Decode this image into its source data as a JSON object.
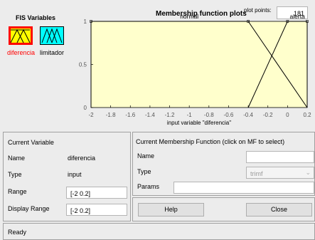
{
  "fis_variables": {
    "title": "FIS Variables",
    "inputs": [
      {
        "name": "diferencia",
        "selected": true
      }
    ],
    "outputs": [
      {
        "name": "limitador"
      }
    ]
  },
  "plot": {
    "title": "Membership function plots",
    "plot_points_label": "plot points:",
    "plot_points_value": "181",
    "xlabel": "input variable \"diferencia\""
  },
  "chart_data": {
    "type": "line",
    "title": "Membership function plots",
    "xlabel": "input variable \"diferencia\"",
    "ylabel": "",
    "xlim": [
      -2,
      0.2
    ],
    "ylim": [
      0,
      1
    ],
    "x_ticks": [
      "-2",
      "-1.8",
      "-1.6",
      "-1.4",
      "-1.2",
      "-1",
      "-0.8",
      "-0.6",
      "-0.4",
      "-0.2",
      "0",
      "0.2"
    ],
    "y_ticks": [
      "0",
      "0.5",
      "1"
    ],
    "background": "#ffffcc",
    "series": [
      {
        "name": "normal",
        "x": [
          -2,
          -2,
          -0.4,
          0.2
        ],
        "y": [
          0,
          1,
          1,
          0
        ],
        "color": "#000000"
      },
      {
        "name": "alerta",
        "x": [
          -0.4,
          0.0,
          0.2,
          0.2
        ],
        "y": [
          0,
          1,
          1,
          0
        ],
        "color": "#000000"
      }
    ]
  },
  "current_variable": {
    "title": "Current Variable",
    "name_label": "Name",
    "name_value": "diferencia",
    "type_label": "Type",
    "type_value": "input",
    "range_label": "Range",
    "range_value": "[-2 0.2]",
    "display_range_label": "Display Range",
    "display_range_value": "[-2 0.2]"
  },
  "current_mf": {
    "title": "Current Membership Function (click on MF to select)",
    "name_label": "Name",
    "name_value": "",
    "type_label": "Type",
    "type_value": "trimf",
    "params_label": "Params",
    "params_value": ""
  },
  "buttons": {
    "help": "Help",
    "close": "Close"
  },
  "status": "Ready",
  "colors": {
    "selected_border": "#ff0000",
    "input_fill": "#ffff00",
    "output_fill": "#00ffff",
    "plot_bg": "#ffffcc"
  }
}
